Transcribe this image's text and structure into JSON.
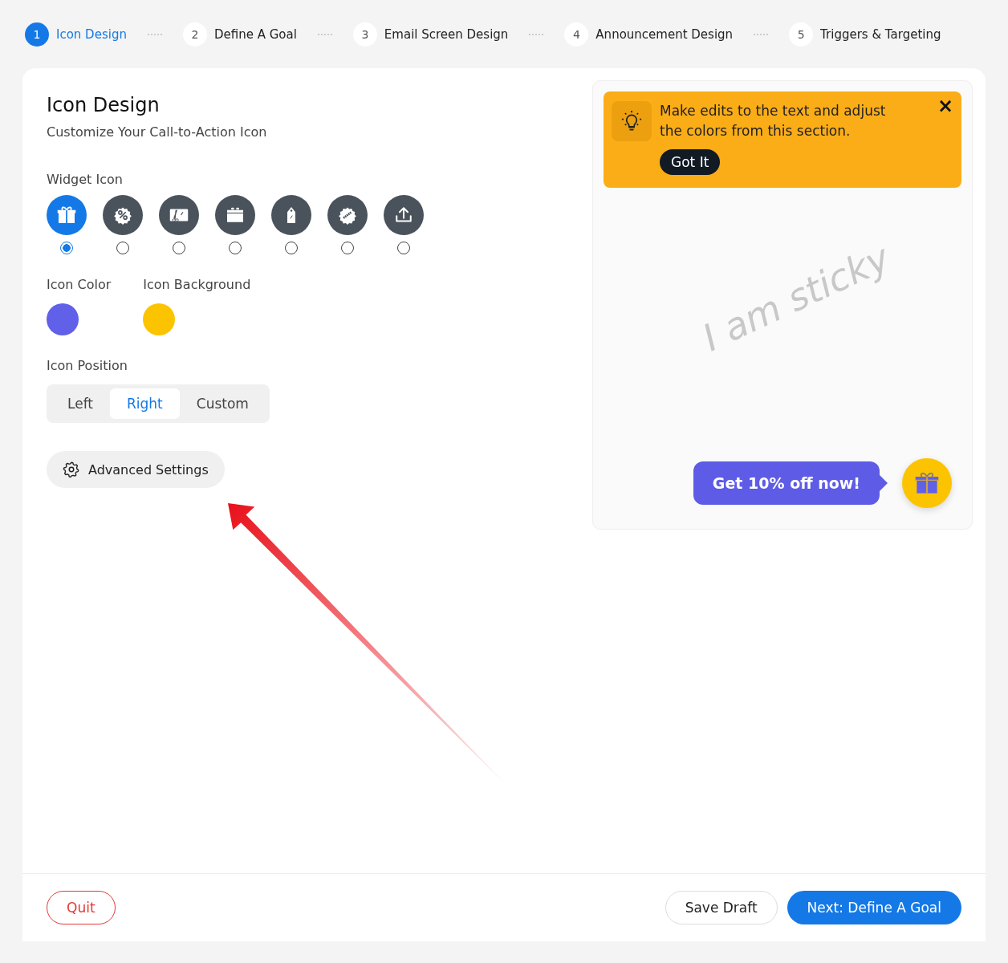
{
  "steps": [
    {
      "number": "1",
      "label": "Icon Design",
      "selected": true
    },
    {
      "number": "2",
      "label": "Define A Goal",
      "selected": false
    },
    {
      "number": "3",
      "label": "Email Screen Design",
      "selected": false
    },
    {
      "number": "4",
      "label": "Announcement Design",
      "selected": false
    },
    {
      "number": "5",
      "label": "Triggers & Targeting",
      "selected": false
    }
  ],
  "title": "Icon Design",
  "subtitle": "Customize Your Call-to-Action Icon",
  "widget_icon": {
    "label": "Widget Icon",
    "options": [
      {
        "kind": "gift",
        "selected": true
      },
      {
        "kind": "percent",
        "selected": false
      },
      {
        "kind": "coupon",
        "selected": false
      },
      {
        "kind": "box",
        "selected": false
      },
      {
        "kind": "tag",
        "selected": false
      },
      {
        "kind": "sale",
        "selected": false
      },
      {
        "kind": "upload",
        "selected": false
      }
    ]
  },
  "colors": [
    {
      "label": "Icon Color",
      "color": "#6060e8"
    },
    {
      "label": "Icon Background",
      "color": "#fcc400"
    }
  ],
  "position": {
    "label": "Icon Position",
    "options": [
      {
        "label": "Left",
        "selected": false
      },
      {
        "label": "Right",
        "selected": true
      },
      {
        "label": "Custom",
        "selected": false
      }
    ]
  },
  "advanced_settings": "Advanced Settings",
  "preview": {
    "tip": {
      "text": "Make edits to the text and adjust the colors from this section.",
      "button": "Got It",
      "close": "×"
    },
    "watermark_text": "I am sticky",
    "cta": "Get 10% off now!"
  },
  "footer": {
    "quit": "Quit",
    "save": "Save Draft",
    "next": "Next: Define A Goal"
  }
}
